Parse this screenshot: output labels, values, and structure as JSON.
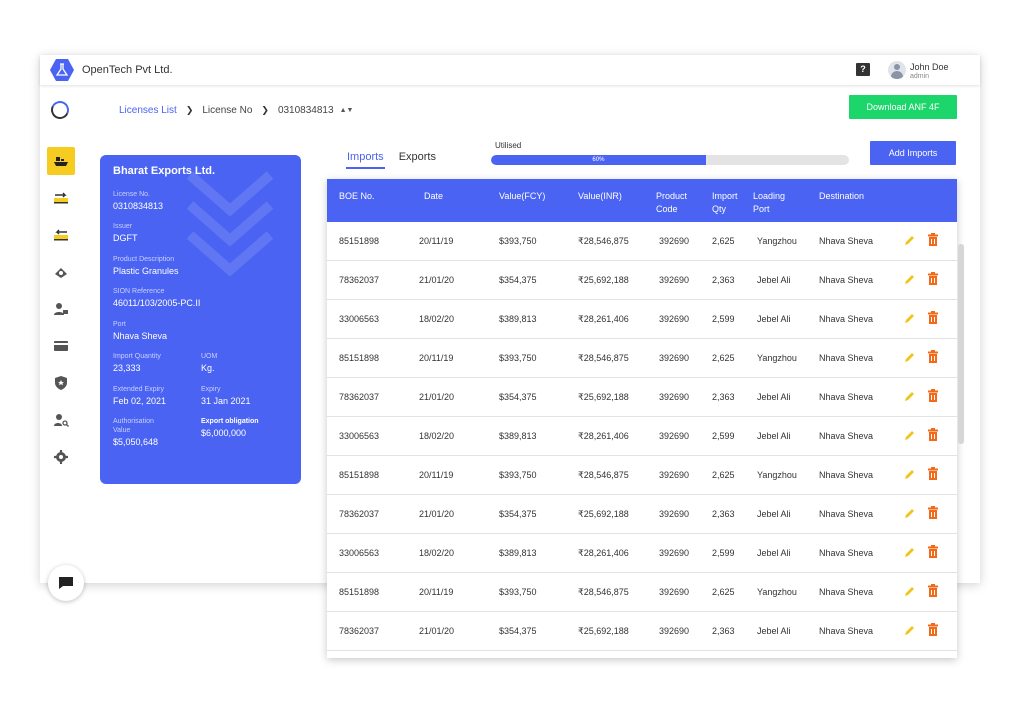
{
  "app": {
    "company": "OpenTech Pvt Ltd.",
    "help": "?",
    "user": {
      "name": "John Doe",
      "role": "admin"
    }
  },
  "sidebar": {
    "items": [
      {
        "icon": "ship-icon",
        "active": true
      },
      {
        "icon": "export-truck-icon",
        "active": false
      },
      {
        "icon": "import-truck-icon",
        "active": false
      },
      {
        "icon": "money-icon",
        "active": false
      },
      {
        "icon": "user-badge-icon",
        "active": false
      },
      {
        "icon": "card-icon",
        "active": false
      },
      {
        "icon": "shield-star-icon",
        "active": false
      },
      {
        "icon": "user-search-icon",
        "active": false
      },
      {
        "icon": "gear-icon",
        "active": false
      }
    ]
  },
  "breadcrumb": {
    "licenses": "Licenses List",
    "license_no_label": "License No",
    "license_no": "0310834813"
  },
  "download_button": "Download ANF 4F",
  "license": {
    "title": "Bharat Exports Ltd.",
    "license_no_label": "License No.",
    "license_no": "0310834813",
    "issuer_label": "Issuer",
    "issuer": "DGFT",
    "product_label": "Product Description",
    "product": "Plastic Granules",
    "sion_label": "SION Reference",
    "sion": "46011/103/2005-PC.II",
    "port_label": "Port",
    "port": "Nhava Sheva",
    "qty_label": "Import Quantity",
    "qty": "23,333",
    "uom_label": "UOM",
    "uom": "Kg.",
    "ext_expiry_label": "Extended Expiry",
    "ext_expiry": "Feb 02, 2021",
    "expiry_label": "Expiry",
    "expiry": "31 Jan 2021",
    "auth_label_1": "Authorisation",
    "auth_label_2": "Value",
    "auth_value": "$5,050,648",
    "export_label": "Export obligation",
    "export_value": "$6,000,000"
  },
  "tabs": [
    {
      "label": "Imports",
      "active": true
    },
    {
      "label": "Exports",
      "active": false
    }
  ],
  "utilised": {
    "label": "Utilised",
    "percent": 60,
    "text": "60%"
  },
  "add_button": "Add Imports",
  "table": {
    "headers": [
      [
        "BOE No."
      ],
      [
        "Date"
      ],
      [
        "Value(FCY)"
      ],
      [
        "Value(INR)"
      ],
      [
        "Product",
        "Code"
      ],
      [
        "Import",
        "Qty"
      ],
      [
        "Loading",
        "Port"
      ],
      [
        "Destination"
      ]
    ],
    "rows": [
      [
        "85151898",
        "20/11/19",
        "$393,750",
        "₹28,546,875",
        "392690",
        "2,625",
        "Yangzhou",
        "Nhava Sheva"
      ],
      [
        "78362037",
        "21/01/20",
        "$354,375",
        "₹25,692,188",
        "392690",
        "2,363",
        "Jebel Ali",
        "Nhava Sheva"
      ],
      [
        "33006563",
        "18/02/20",
        "$389,813",
        "₹28,261,406",
        "392690",
        "2,599",
        "Jebel Ali",
        "Nhava Sheva"
      ],
      [
        "85151898",
        "20/11/19",
        "$393,750",
        "₹28,546,875",
        "392690",
        "2,625",
        "Yangzhou",
        "Nhava Sheva"
      ],
      [
        "78362037",
        "21/01/20",
        "$354,375",
        "₹25,692,188",
        "392690",
        "2,363",
        "Jebel Ali",
        "Nhava Sheva"
      ],
      [
        "33006563",
        "18/02/20",
        "$389,813",
        "₹28,261,406",
        "392690",
        "2,599",
        "Jebel Ali",
        "Nhava Sheva"
      ],
      [
        "85151898",
        "20/11/19",
        "$393,750",
        "₹28,546,875",
        "392690",
        "2,625",
        "Yangzhou",
        "Nhava Sheva"
      ],
      [
        "78362037",
        "21/01/20",
        "$354,375",
        "₹25,692,188",
        "392690",
        "2,363",
        "Jebel Ali",
        "Nhava Sheva"
      ],
      [
        "33006563",
        "18/02/20",
        "$389,813",
        "₹28,261,406",
        "392690",
        "2,599",
        "Jebel Ali",
        "Nhava Sheva"
      ],
      [
        "85151898",
        "20/11/19",
        "$393,750",
        "₹28,546,875",
        "392690",
        "2,625",
        "Yangzhou",
        "Nhava Sheva"
      ],
      [
        "78362037",
        "21/01/20",
        "$354,375",
        "₹25,692,188",
        "392690",
        "2,363",
        "Jebel Ali",
        "Nhava Sheva"
      ]
    ]
  },
  "colors": {
    "primary": "#4a63f2",
    "success": "#1cd66b",
    "edit": "#f0c419",
    "delete": "#f06a1a",
    "active_nav": "#f5cc1f"
  }
}
